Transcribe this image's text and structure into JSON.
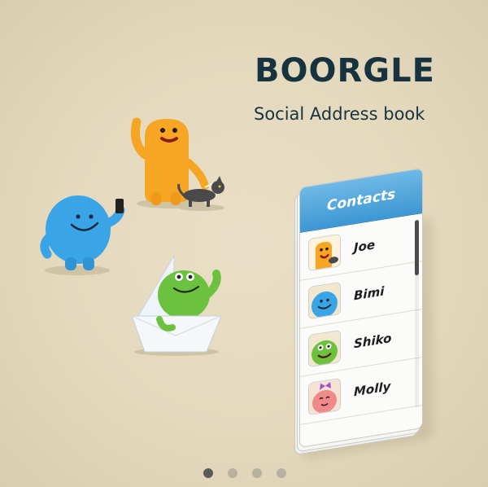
{
  "app": {
    "title": "BOORGLE",
    "subtitle": "Social Address book"
  },
  "contacts_panel": {
    "header": "Contacts",
    "items": [
      {
        "name": "Joe",
        "avatar_icon": "orange-monster-avatar-icon",
        "color": "#f2a31c"
      },
      {
        "name": "Bimi",
        "avatar_icon": "blue-monster-avatar-icon",
        "color": "#3b9ee0"
      },
      {
        "name": "Shiko",
        "avatar_icon": "green-monster-avatar-icon",
        "color": "#6cbf3b"
      },
      {
        "name": "Molly",
        "avatar_icon": "pink-monster-avatar-icon",
        "color": "#f08a8a"
      }
    ]
  },
  "pagination": {
    "pages": 4,
    "active_index": 0
  },
  "colors": {
    "background": "#e6dcc1",
    "title": "#17333f",
    "header_blue": "#3d97d3"
  }
}
